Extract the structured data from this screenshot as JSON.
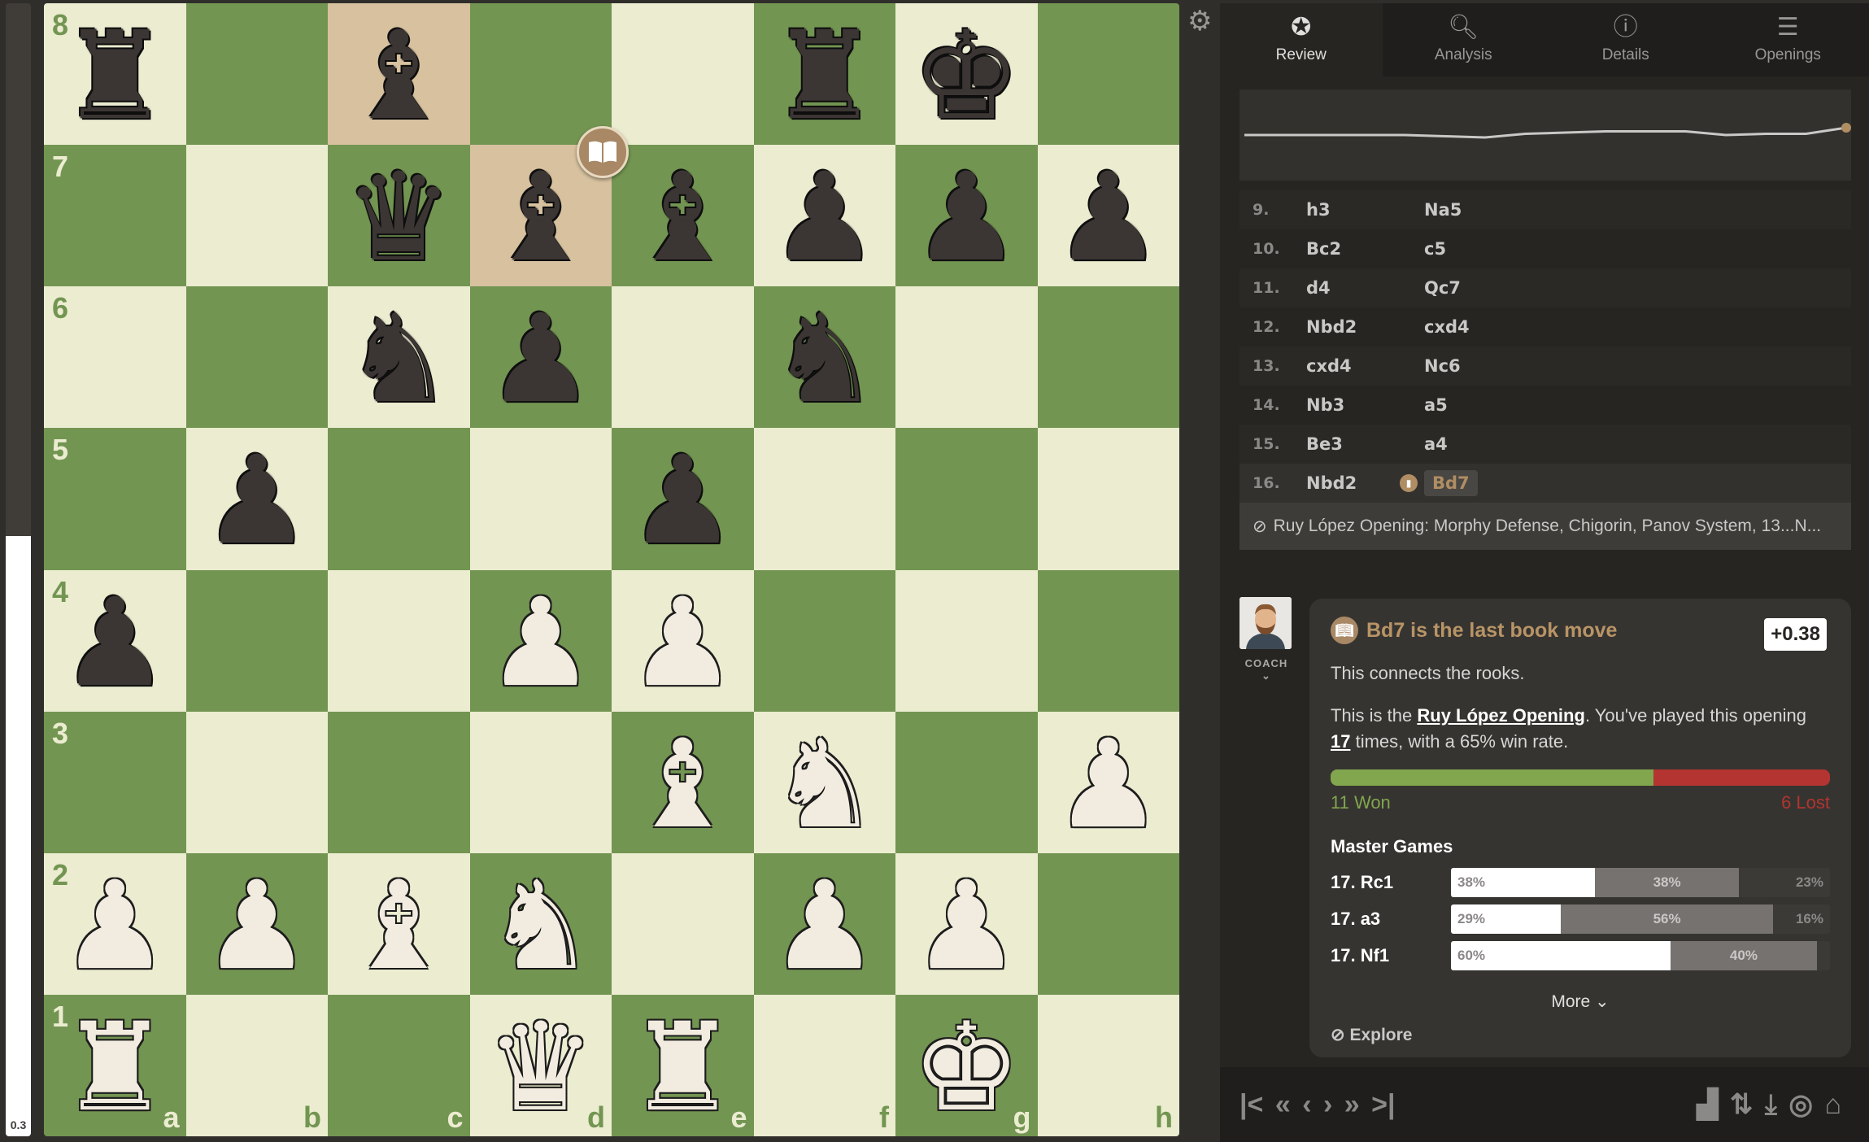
{
  "eval_bar": {
    "value": "0.3",
    "white_fraction": 0.53
  },
  "board": {
    "ranks": [
      "r.b..rk.",
      "..qbbppp",
      "..np.n..",
      ".p..p...",
      "p..PP...",
      "....BN.P",
      "PPBN.PP.",
      "R..QR.K."
    ],
    "files": [
      "a",
      "b",
      "c",
      "d",
      "e",
      "f",
      "g",
      "h"
    ],
    "rank_labels": [
      "8",
      "7",
      "6",
      "5",
      "4",
      "3",
      "2",
      "1"
    ],
    "highlights": [
      "c8",
      "d7"
    ],
    "book_marker": "d7",
    "colors": {
      "light": "#ebecd0",
      "dark": "#739552",
      "highlight": "#d7c19f"
    }
  },
  "settings_icon": "gear-icon",
  "tabs": [
    {
      "label": "Review",
      "icon": "star-icon",
      "active": true
    },
    {
      "label": "Analysis",
      "icon": "magnifier-chart-icon"
    },
    {
      "label": "Details",
      "icon": "info-icon"
    },
    {
      "label": "Openings",
      "icon": "book-stack-icon"
    }
  ],
  "eval_graph": [
    0,
    0,
    0,
    0,
    0,
    -0.05,
    -0.1,
    0.05,
    0.1,
    0.15,
    0.15,
    0.15,
    0,
    0.05,
    0.05,
    0.3
  ],
  "moves": [
    {
      "n": "9.",
      "w": "h3",
      "b": "Na5"
    },
    {
      "n": "10.",
      "w": "Bc2",
      "b": "c5"
    },
    {
      "n": "11.",
      "w": "d4",
      "b": "Qc7"
    },
    {
      "n": "12.",
      "w": "Nbd2",
      "b": "cxd4"
    },
    {
      "n": "13.",
      "w": "cxd4",
      "b": "Nc6"
    },
    {
      "n": "14.",
      "w": "Nb3",
      "b": "a5"
    },
    {
      "n": "15.",
      "w": "Be3",
      "b": "a4"
    },
    {
      "n": "16.",
      "w": "Nbd2",
      "b": "Bd7",
      "current": true
    }
  ],
  "opening_name": "Ruy López Opening: Morphy Defense, Chigorin, Panov System, 13...N...",
  "coach": {
    "label": "COACH",
    "title": "Bd7 is the last book move",
    "eval": "+0.38",
    "line1": "This connects the rooks.",
    "p2_a": "This is the ",
    "p2_link": "Ruy López Opening",
    "p2_b": ". You've played this opening ",
    "p2_count": "17",
    "p2_c": " times, with a 65% win rate.",
    "won": 11,
    "lost": 6,
    "won_label": "11 Won",
    "lost_label": "6 Lost",
    "won_color": "#81a64e",
    "lost_color": "#b33430",
    "master_title": "Master Games",
    "master": [
      {
        "move": "17. Rc1",
        "white": "38%",
        "draw": "38%",
        "black": "23%",
        "w": 38,
        "d": 38,
        "bl": 23
      },
      {
        "move": "17. a3",
        "white": "29%",
        "draw": "56%",
        "black": "16%",
        "w": 29,
        "d": 56,
        "bl": 16
      },
      {
        "move": "17. Nf1",
        "white": "60%",
        "draw": "40%",
        "black": "",
        "w": 60,
        "d": 40,
        "bl": 0
      }
    ],
    "more": "More",
    "explore": "Explore"
  },
  "toolbar": {
    "nav": [
      "first-move",
      "back-10",
      "prev",
      "next",
      "fwd-10",
      "last-move"
    ],
    "tools": [
      "chart",
      "flip",
      "download",
      "target",
      "library-add"
    ]
  }
}
